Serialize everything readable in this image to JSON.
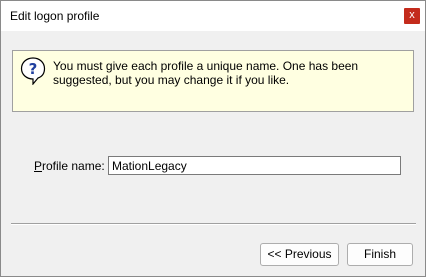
{
  "window": {
    "title": "Edit logon profile",
    "close_label": "x"
  },
  "info": {
    "icon": "question-icon",
    "message": "You must give each profile a unique name.  One has been suggested, but you may change it if you like."
  },
  "form": {
    "label_first": "P",
    "label_rest": "rofile name:",
    "value": "MationLegacy"
  },
  "buttons": {
    "previous": "<< Previous",
    "finish": "Finish"
  },
  "colors": {
    "info_background": "#ffffe1",
    "close_button": "#c42b1c",
    "icon_blue": "#1f3f9f"
  }
}
